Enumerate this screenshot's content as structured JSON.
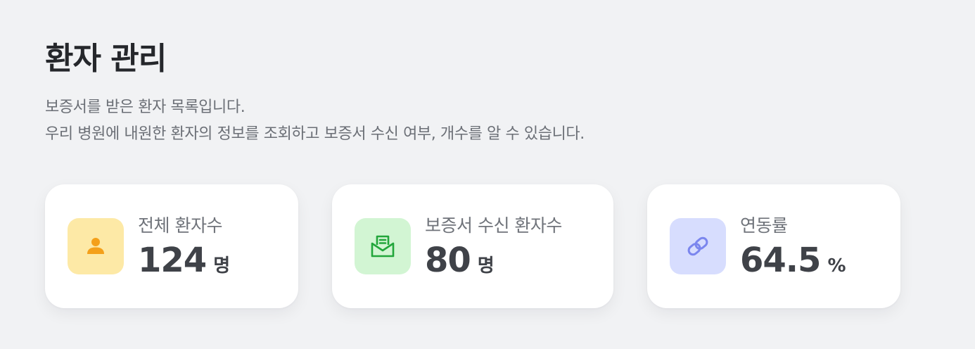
{
  "header": {
    "title": "환자 관리",
    "description_line1": "보증서를 받은 환자 목록입니다.",
    "description_line2": "우리 병원에 내원한 환자의 정보를 조회하고 보증서 수신 여부, 개수를 알 수 있습니다."
  },
  "stats": [
    {
      "label": "전체 환자수",
      "value": "124",
      "unit": "명",
      "icon": "person-icon",
      "icon_color": "#f4a01a",
      "bg_color": "#fde9a6"
    },
    {
      "label": "보증서 수신 환자수",
      "value": "80",
      "unit": "명",
      "icon": "mail-document-icon",
      "icon_color": "#22a63b",
      "bg_color": "#d2f5d3"
    },
    {
      "label": "연동률",
      "value": "64.5",
      "unit": "%",
      "icon": "link-icon",
      "icon_color": "#7b86ee",
      "bg_color": "#d7ddfe"
    }
  ]
}
